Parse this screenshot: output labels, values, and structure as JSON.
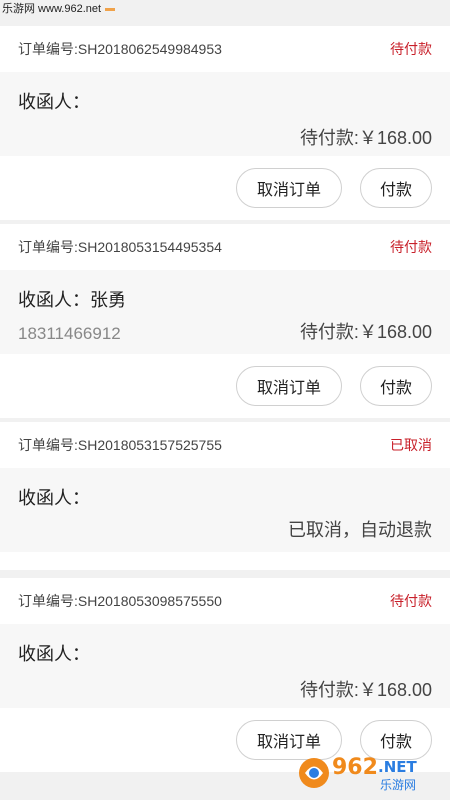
{
  "watermark": {
    "text": "乐游网 www.962.net"
  },
  "orders": [
    {
      "order_no": "订单编号:SH2018062549984953",
      "status": "待付款",
      "recipient": "收函人：",
      "phone": "",
      "amount": "待付款:￥168.00",
      "cancel_label": "取消订单",
      "pay_label": "付款"
    },
    {
      "order_no": "订单编号:SH2018053154495354",
      "status": "待付款",
      "recipient": "收函人：张勇",
      "phone": "18311466912",
      "amount": "待付款:￥168.00",
      "cancel_label": "取消订单",
      "pay_label": "付款"
    },
    {
      "order_no": "订单编号:SH2018053157525755",
      "status": "已取消",
      "recipient": "收函人：",
      "phone": "",
      "amount": "已取消，自动退款"
    },
    {
      "order_no": "订单编号:SH2018053098575550",
      "status": "待付款",
      "recipient": "收函人：",
      "phone": "",
      "amount": "待付款:￥168.00",
      "cancel_label": "取消订单",
      "pay_label": "付款"
    }
  ],
  "logo": {
    "text_main": "962",
    "text_net": ".NET",
    "text_cn": "乐游网",
    "colors": {
      "orange": "#f08a1c",
      "blue": "#2a7de1"
    }
  }
}
